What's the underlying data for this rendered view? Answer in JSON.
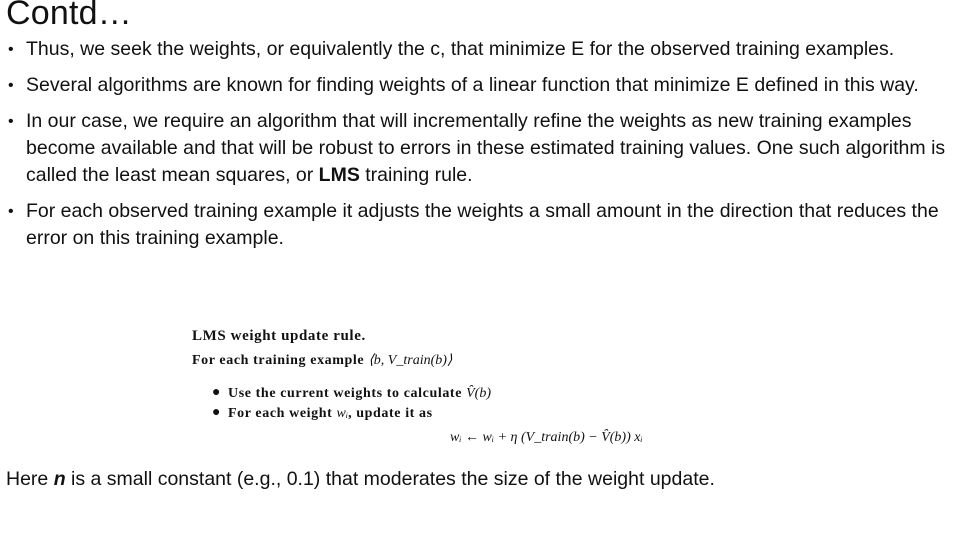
{
  "slide": {
    "title": "Contd…",
    "bullets": [
      {
        "text": "Thus, we seek the weights, or equivalently the c, that minimize E for the observed training examples."
      },
      {
        "text": "Several algorithms are known for finding weights of a linear function that minimize E defined in this way."
      },
      {
        "text_before_bold": "In our case, we require an algorithm that will incrementally refine the weights as new training examples become available and that will be robust to errors in these estimated training values. One such algorithm is called the least mean squares, or ",
        "bold": "LMS",
        "text_after_bold": " training rule."
      },
      {
        "text": "For each observed training example it adjusts the weights a small amount in the direction that reduces the error on this training example."
      }
    ],
    "bullet_glyph": "•",
    "figure": {
      "title": "LMS weight update rule.",
      "for_each_label": "For each training example",
      "for_each_math": "⟨b, V_train(b)⟩",
      "items": [
        {
          "bullet": "●",
          "text": "Use the current weights to calculate",
          "math": "V̂(b)"
        },
        {
          "bullet": "●",
          "text": "For each weight",
          "math": "wᵢ",
          "text_after": ", update it as"
        }
      ],
      "equation": "wᵢ ← wᵢ + η (V_train(b) − V̂(b)) xᵢ"
    },
    "footer": {
      "prefix": "Here ",
      "symbol": "n",
      "suffix": " is a small constant (e.g., 0.1) that moderates the size of the weight update."
    }
  }
}
